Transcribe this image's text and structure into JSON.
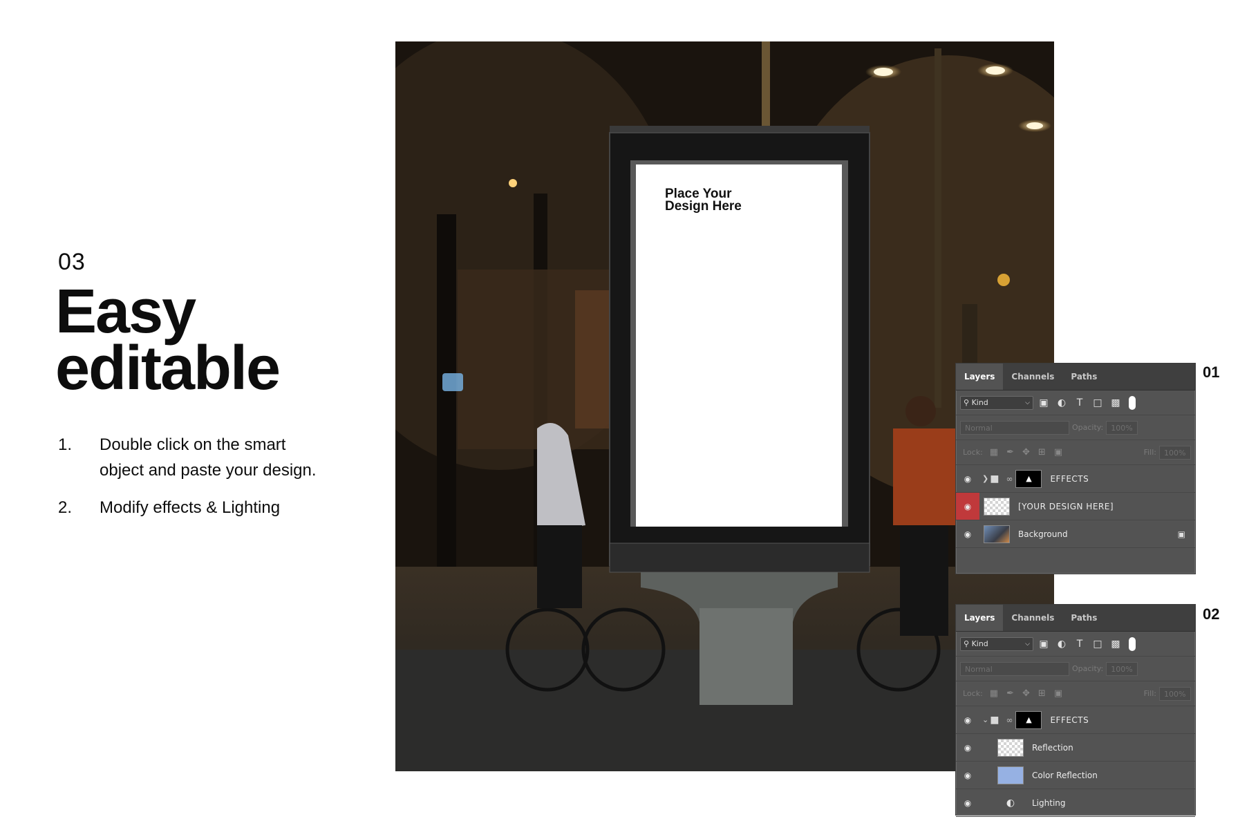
{
  "intro": {
    "step_number": "03",
    "title_line1": "Easy",
    "title_line2": "editable",
    "steps": [
      {
        "num": "1.",
        "line1": "Double click on the smart",
        "line2": "object and paste your design."
      },
      {
        "num": "2.",
        "line1": "Modify effects & Lighting",
        "line2": ""
      }
    ]
  },
  "mockup": {
    "poster_line1": "Place Your",
    "poster_line2": "Design Here"
  },
  "panel1": {
    "label": "01",
    "tabs": [
      "Layers",
      "Channels",
      "Paths"
    ],
    "filter_kind": "Kind",
    "blend_mode": "Normal",
    "opacity_label": "Opacity:",
    "opacity_value": "100%",
    "lock_label": "Lock:",
    "fill_label": "Fill:",
    "fill_value": "100%",
    "layers": [
      {
        "name": "EFFECTS"
      },
      {
        "name": "[YOUR DESIGN HERE]"
      },
      {
        "name": "Background"
      }
    ]
  },
  "panel2": {
    "label": "02",
    "tabs": [
      "Layers",
      "Channels",
      "Paths"
    ],
    "filter_kind": "Kind",
    "blend_mode": "Normal",
    "opacity_label": "Opacity:",
    "opacity_value": "100%",
    "lock_label": "Lock:",
    "fill_label": "Fill:",
    "fill_value": "100%",
    "layers": [
      {
        "name": "EFFECTS"
      },
      {
        "name": "Reflection"
      },
      {
        "name": "Color Reflection"
      },
      {
        "name": "Lighting"
      }
    ]
  },
  "colors": {
    "panel_bg": "#535353",
    "selected_eye": "#c0393b",
    "color_reflection_swatch": "#96b1e3"
  }
}
